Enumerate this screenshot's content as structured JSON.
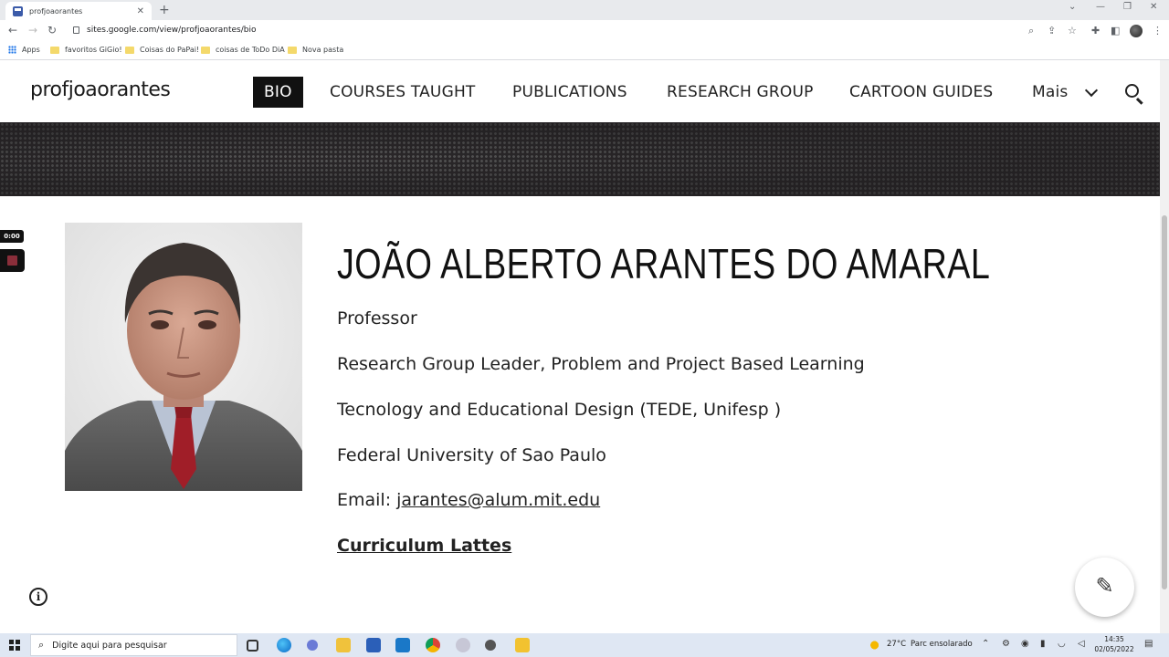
{
  "browser": {
    "tab_title": "profjoaorantes",
    "tab_close": "✕",
    "new_tab": "+",
    "url": "sites.google.com/view/profjoaorantes/bio",
    "bookmarks": [
      "Apps",
      "favoritos GiGio!",
      "Coisas do PaPai!",
      "coisas de ToDo DiA",
      "Nova pasta"
    ]
  },
  "site": {
    "title": "profjoaorantes",
    "nav": [
      "BIO",
      "COURSES TAUGHT",
      "PUBLICATIONS",
      "RESEARCH GROUP",
      "CARTOON GUIDES",
      "Mais"
    ]
  },
  "recorder": {
    "time": "0:00"
  },
  "bio": {
    "name": "JOÃO ALBERTO ARANTES DO AMARAL",
    "role": "Professor",
    "group": "Research Group Leader, Problem and Project Based Learning",
    "dept": "Tecnology and Educational Design (TEDE, Unifesp )",
    "university": "Federal University of Sao Paulo",
    "email_label": "Email: ",
    "email": "jarantes@alum.mit.edu",
    "cv_link": "Curriculum Lattes"
  },
  "fab": {
    "info": "i",
    "edit": "✎"
  },
  "taskbar": {
    "search_placeholder": "Digite aqui para pesquisar",
    "weather_temp": "27°C",
    "weather_desc": "Parc ensolarado",
    "time": "14:35",
    "date": "02/05/2022"
  }
}
